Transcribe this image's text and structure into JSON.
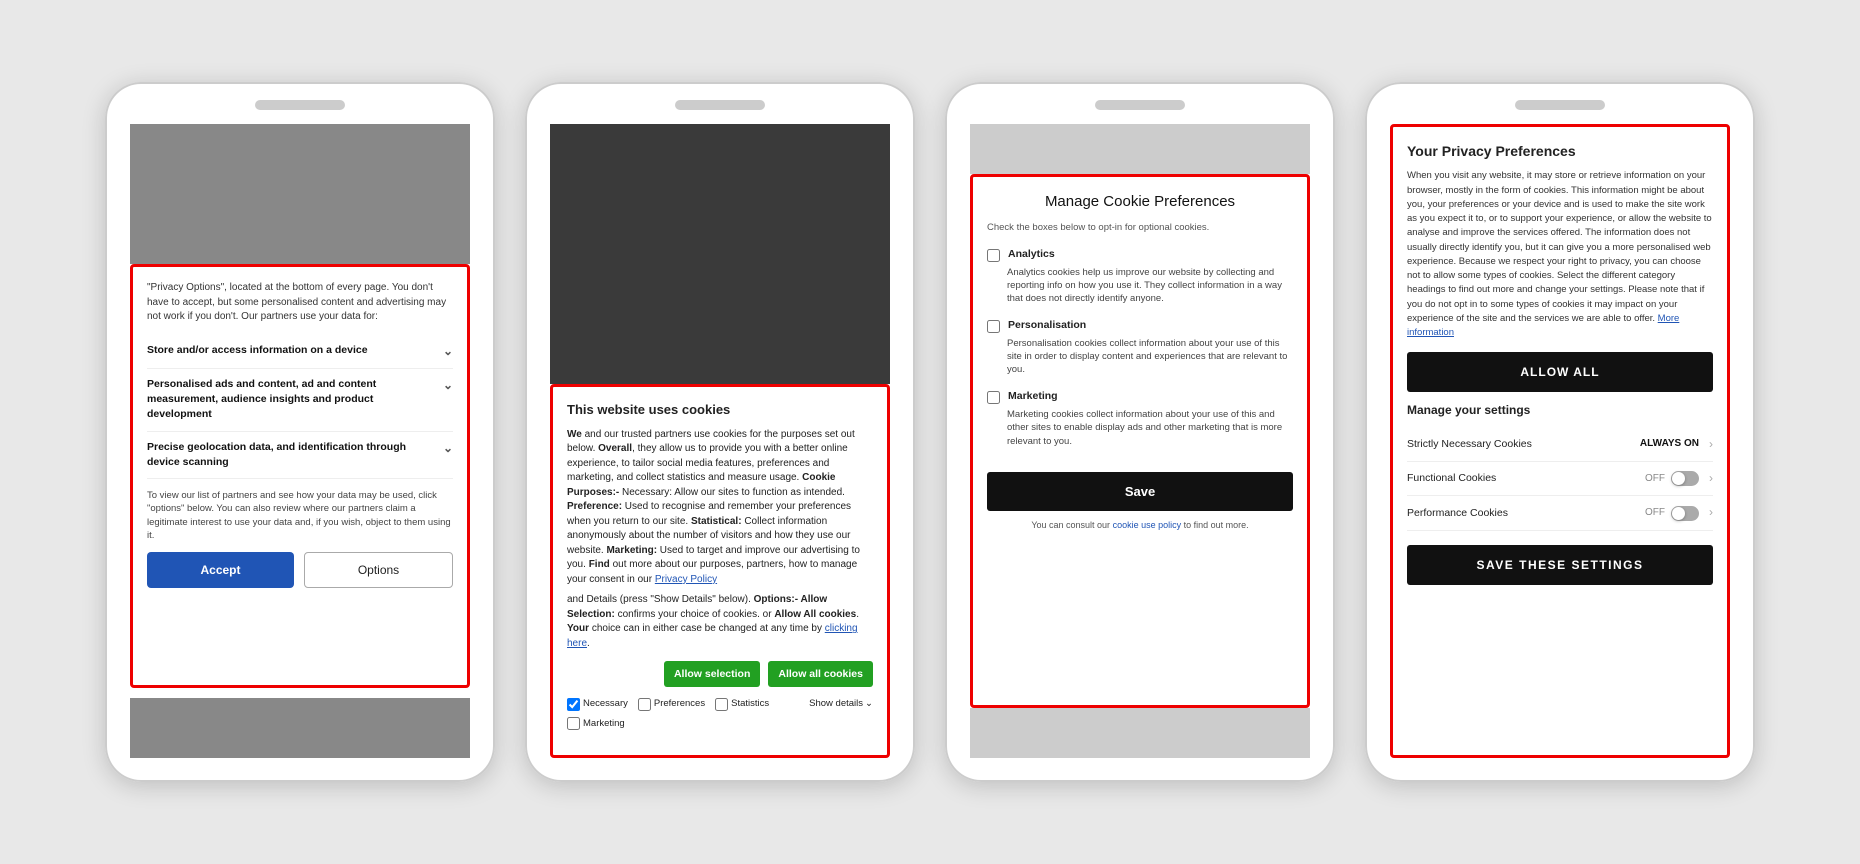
{
  "phone1": {
    "intro": "\"Privacy Options\", located at the bottom of every page. You don't have to accept, but some personalised content and advertising may not work if you don't. Our partners use your data for:",
    "option1": "Store and/or access information on a device",
    "option2": "Personalised ads and content, ad and content measurement, audience insights and product development",
    "option3": "Precise geolocation data, and identification through device scanning",
    "footer": "To view our list of partners and see how your data may be used, click \"options\" below. You can also review where our partners claim a legitimate interest to use your data and, if you wish, object to them using it.",
    "accept_label": "Accept",
    "options_label": "Options"
  },
  "phone2": {
    "title": "This website uses cookies",
    "body1": "We and our trusted partners use cookies for the purposes set out below. Overall, they allow us to provide you with a better online experience, to tailor social media features, preferences and marketing, and collect statistics and measure usage.",
    "body2_bold": "Cookie Purposes:-",
    "body2": " Necessary: Allow our sites to function as intended. Preference: Used to recognise and remember your preferences when you return to our site. Statistical: Collect information anonymously about the number of visitors and how they use our website. Marketing: Used to target and improve our advertising to you. Find out more about our purposes, partners, how to manage your consent in our",
    "privacy_policy_link": "Privacy Policy",
    "body3": "and Details (press \"Show Details\" below).",
    "options_text": "Options:- Allow Selection: confirms your choice of cookies. or Allow All cookies. Your choice can in either case be changed at any time by",
    "clicking_here_link": "clicking here",
    "allow_selection_label": "Allow selection",
    "allow_all_cookies_label": "Allow all cookies",
    "check_necessary": "Necessary",
    "check_preferences": "Preferences",
    "check_statistics": "Statistics",
    "check_marketing": "Marketing",
    "show_details_label": "Show details"
  },
  "phone3": {
    "title": "Manage Cookie Preferences",
    "subtitle": "Check the boxes below to opt-in for optional cookies.",
    "option1_label": "Analytics",
    "option1_desc": "Analytics cookies help us improve our website by collecting and reporting info on how you use it. They collect information in a way that does not directly identify anyone.",
    "option2_label": "Personalisation",
    "option2_desc": "Personalisation cookies collect information about your use of this site in order to display content and experiences that are relevant to you.",
    "option3_label": "Marketing",
    "option3_desc": "Marketing cookies collect information about your use of this and other sites to enable display ads and other marketing that is more relevant to you.",
    "save_label": "Save",
    "consult_text": "You can consult our",
    "cookie_policy_link": "cookie use policy",
    "consult_text2": "to find out more."
  },
  "phone4": {
    "title": "Your Privacy Preferences",
    "body": "When you visit any website, it may store or retrieve information on your browser, mostly in the form of cookies. This information might be about you, your preferences or your device and is used to make the site work as you expect it to, or to support your experience, or allow the website to analyse and improve the services offered. The information does not usually directly identify you, but it can give you a more personalised web experience. Because we respect your right to privacy, you can choose not to allow some types of cookies. Select the different category headings to find out more and change your settings. Please note that if you do not opt in to some types of cookies it may impact on your experience of the site and the services we are able to offer.",
    "more_info_link": "More information",
    "allow_all_label": "ALLOW ALL",
    "manage_title": "Manage your settings",
    "setting1_name": "Strictly Necessary Cookies",
    "setting1_value": "ALWAYS ON",
    "setting2_name": "Functional Cookies",
    "setting2_value": "OFF",
    "setting3_name": "Performance Cookies",
    "setting3_value": "OFF",
    "save_settings_label": "SAVE THESE SETTINGS"
  }
}
